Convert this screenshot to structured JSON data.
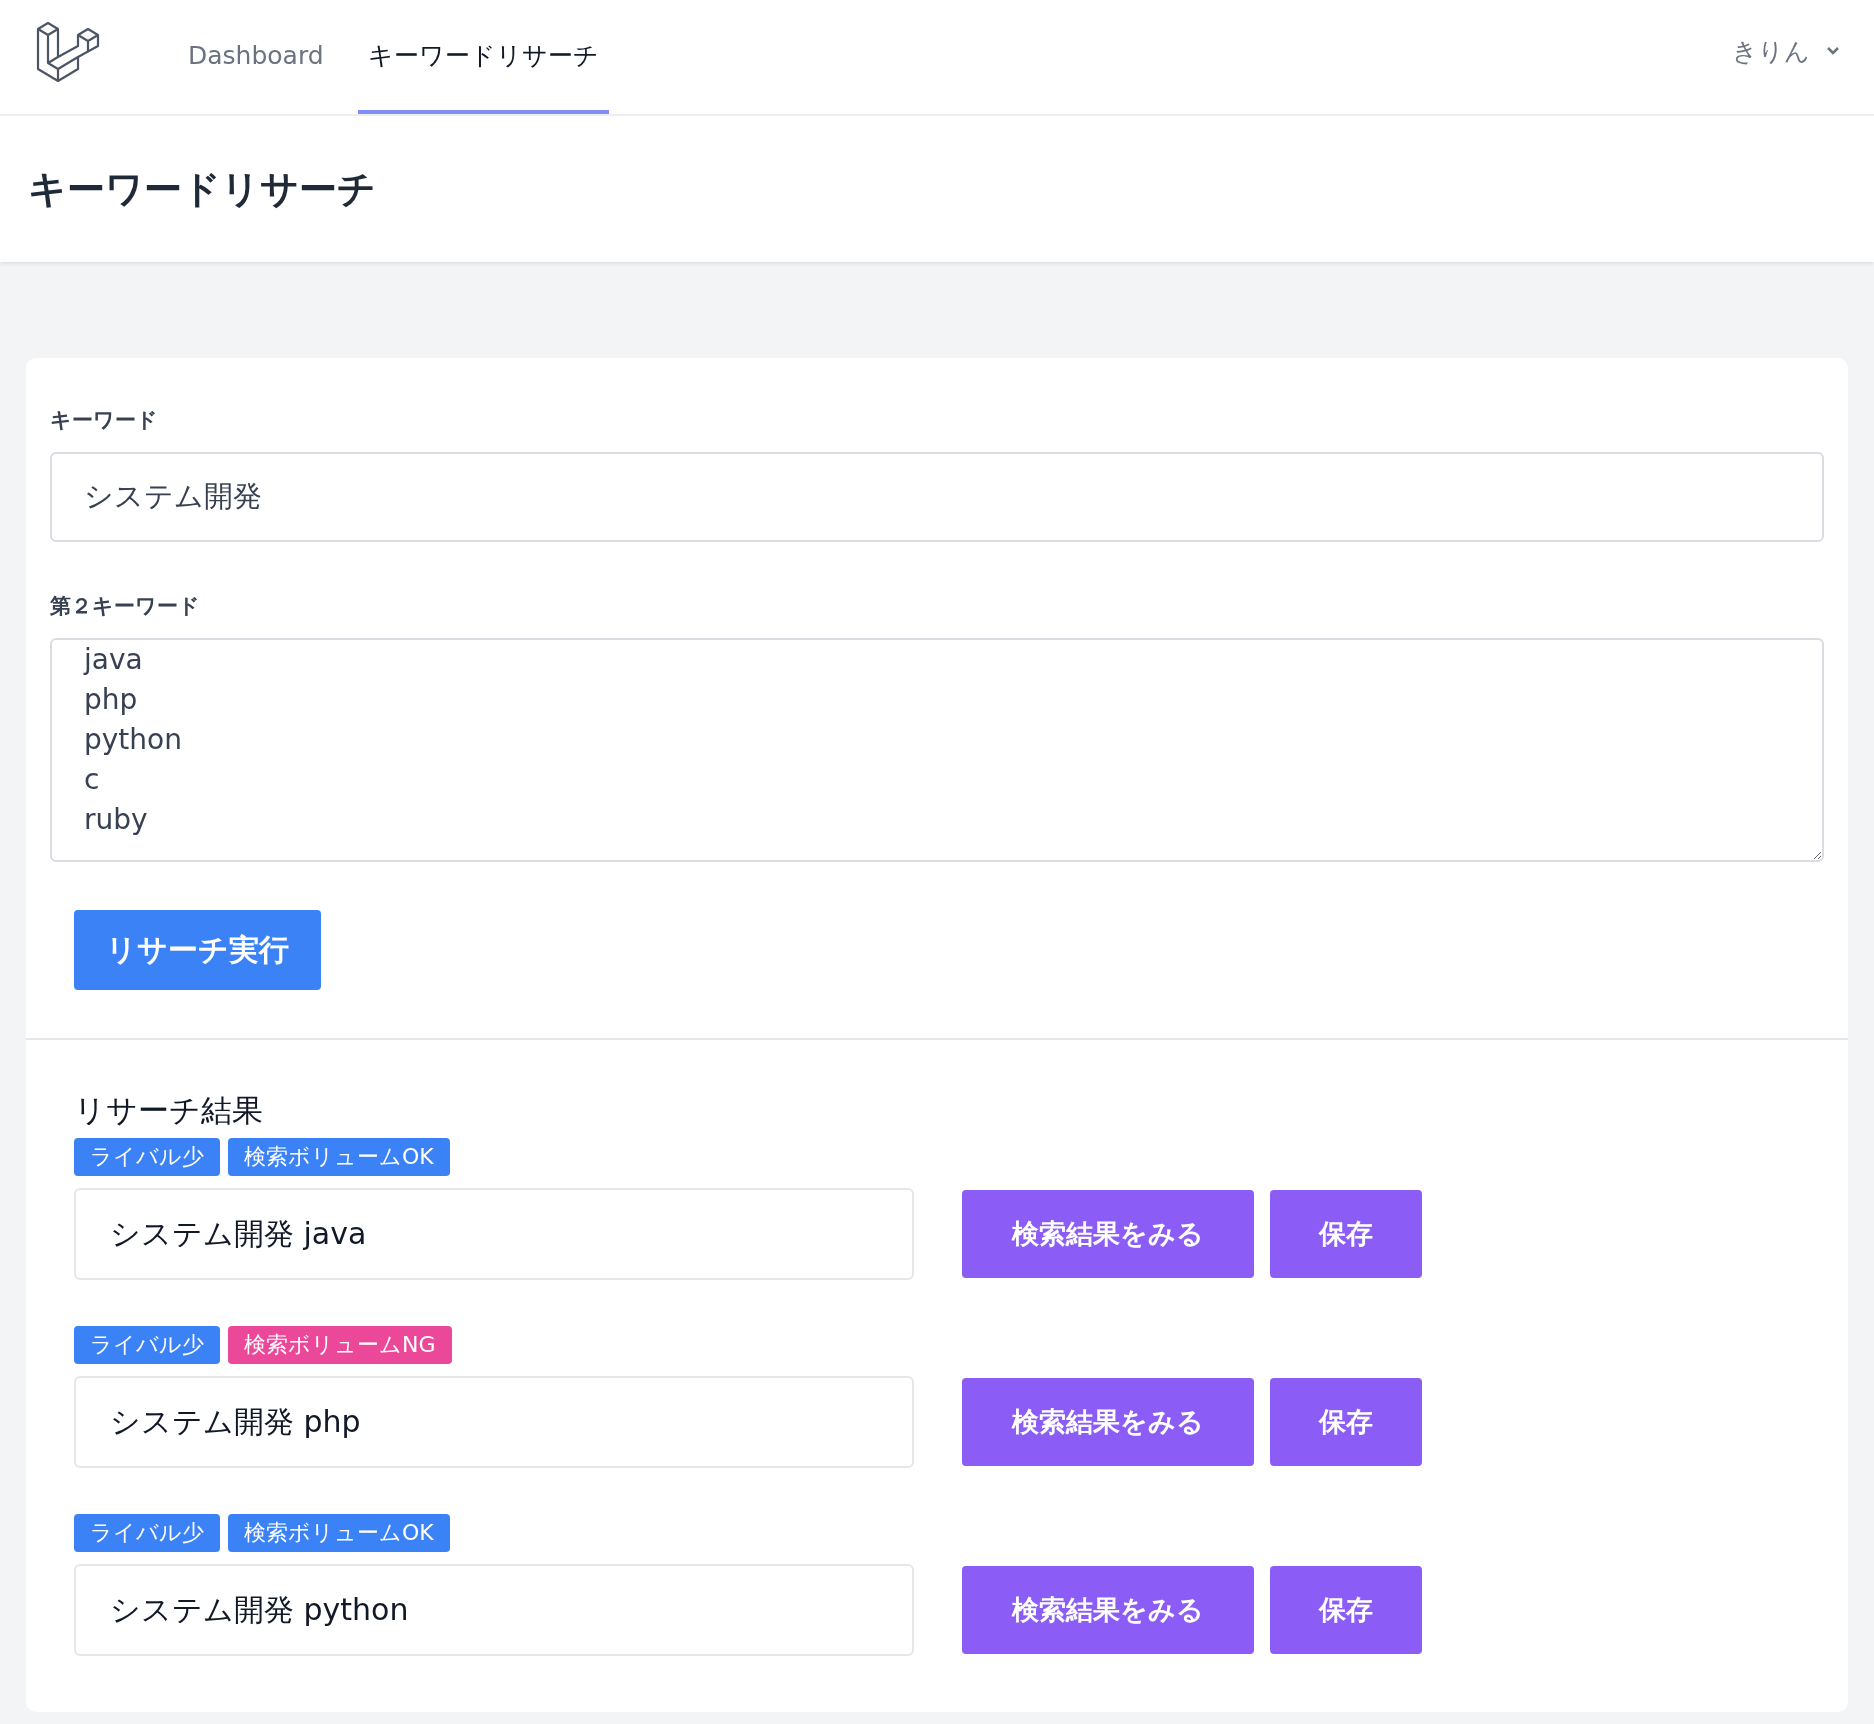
{
  "nav": {
    "items": [
      {
        "label": "Dashboard",
        "selected": false
      },
      {
        "label": "キーワードリサーチ",
        "selected": true
      }
    ],
    "user": "きりん"
  },
  "page_title": "キーワードリサーチ",
  "form": {
    "keyword": {
      "label": "キーワード",
      "value": "システム開発"
    },
    "second_keyword": {
      "label": "第２キーワード",
      "value": "java\nphp\npython\nc\nruby"
    },
    "submit": "リサーチ実行"
  },
  "results": {
    "title": "リサーチ結果",
    "rows": [
      {
        "tags": [
          {
            "label": "ライバル少",
            "color": "#3b82f6"
          },
          {
            "label": "検索ボリュームOK",
            "color": "#3b82f6"
          }
        ],
        "value": "システム開発 java",
        "view_button": "検索結果をみる",
        "save_button": "保存"
      },
      {
        "tags": [
          {
            "label": "ライバル少",
            "color": "#3b82f6"
          },
          {
            "label": "検索ボリュームNG",
            "color": "#ec4899"
          }
        ],
        "value": "システム開発 php",
        "view_button": "検索結果をみる",
        "save_button": "保存"
      },
      {
        "tags": [
          {
            "label": "ライバル少",
            "color": "#3b82f6"
          },
          {
            "label": "検索ボリュームOK",
            "color": "#3b82f6"
          }
        ],
        "value": "システム開発 python",
        "view_button": "検索結果をみる",
        "save_button": "保存"
      }
    ]
  }
}
